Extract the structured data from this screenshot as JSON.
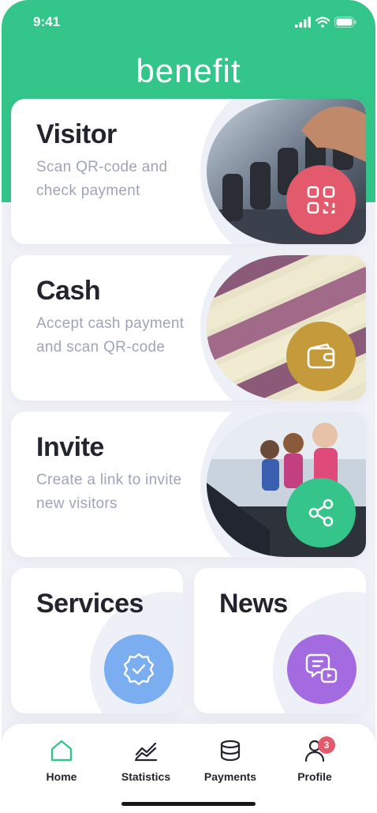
{
  "status": {
    "time": "9:41"
  },
  "brand": "benefit",
  "cards": {
    "visitor": {
      "title": "Visitor",
      "desc": "Scan QR-code and check payment",
      "icon": "qr-code-icon",
      "color": "#e35a6d"
    },
    "cash": {
      "title": "Cash",
      "desc": "Accept cash payment and scan QR-code",
      "icon": "wallet-icon",
      "color": "#c49a3a"
    },
    "invite": {
      "title": "Invite",
      "desc": "Create a link to invite new visitors",
      "icon": "share-icon",
      "color": "#35c48a"
    },
    "services": {
      "title": "Services",
      "icon": "verified-badge-icon",
      "color": "#7aaef0"
    },
    "news": {
      "title": "News",
      "icon": "video-message-icon",
      "color": "#a46ae0"
    }
  },
  "nav": {
    "items": [
      {
        "label": "Home",
        "icon": "home-icon",
        "active": true
      },
      {
        "label": "Statistics",
        "icon": "chart-icon"
      },
      {
        "label": "Payments",
        "icon": "coins-icon"
      },
      {
        "label": "Profile",
        "icon": "user-icon",
        "badge": "3"
      }
    ]
  },
  "colors": {
    "brand_green": "#34c58a",
    "text_dark": "#23242e",
    "text_muted": "#9fa5b8"
  }
}
